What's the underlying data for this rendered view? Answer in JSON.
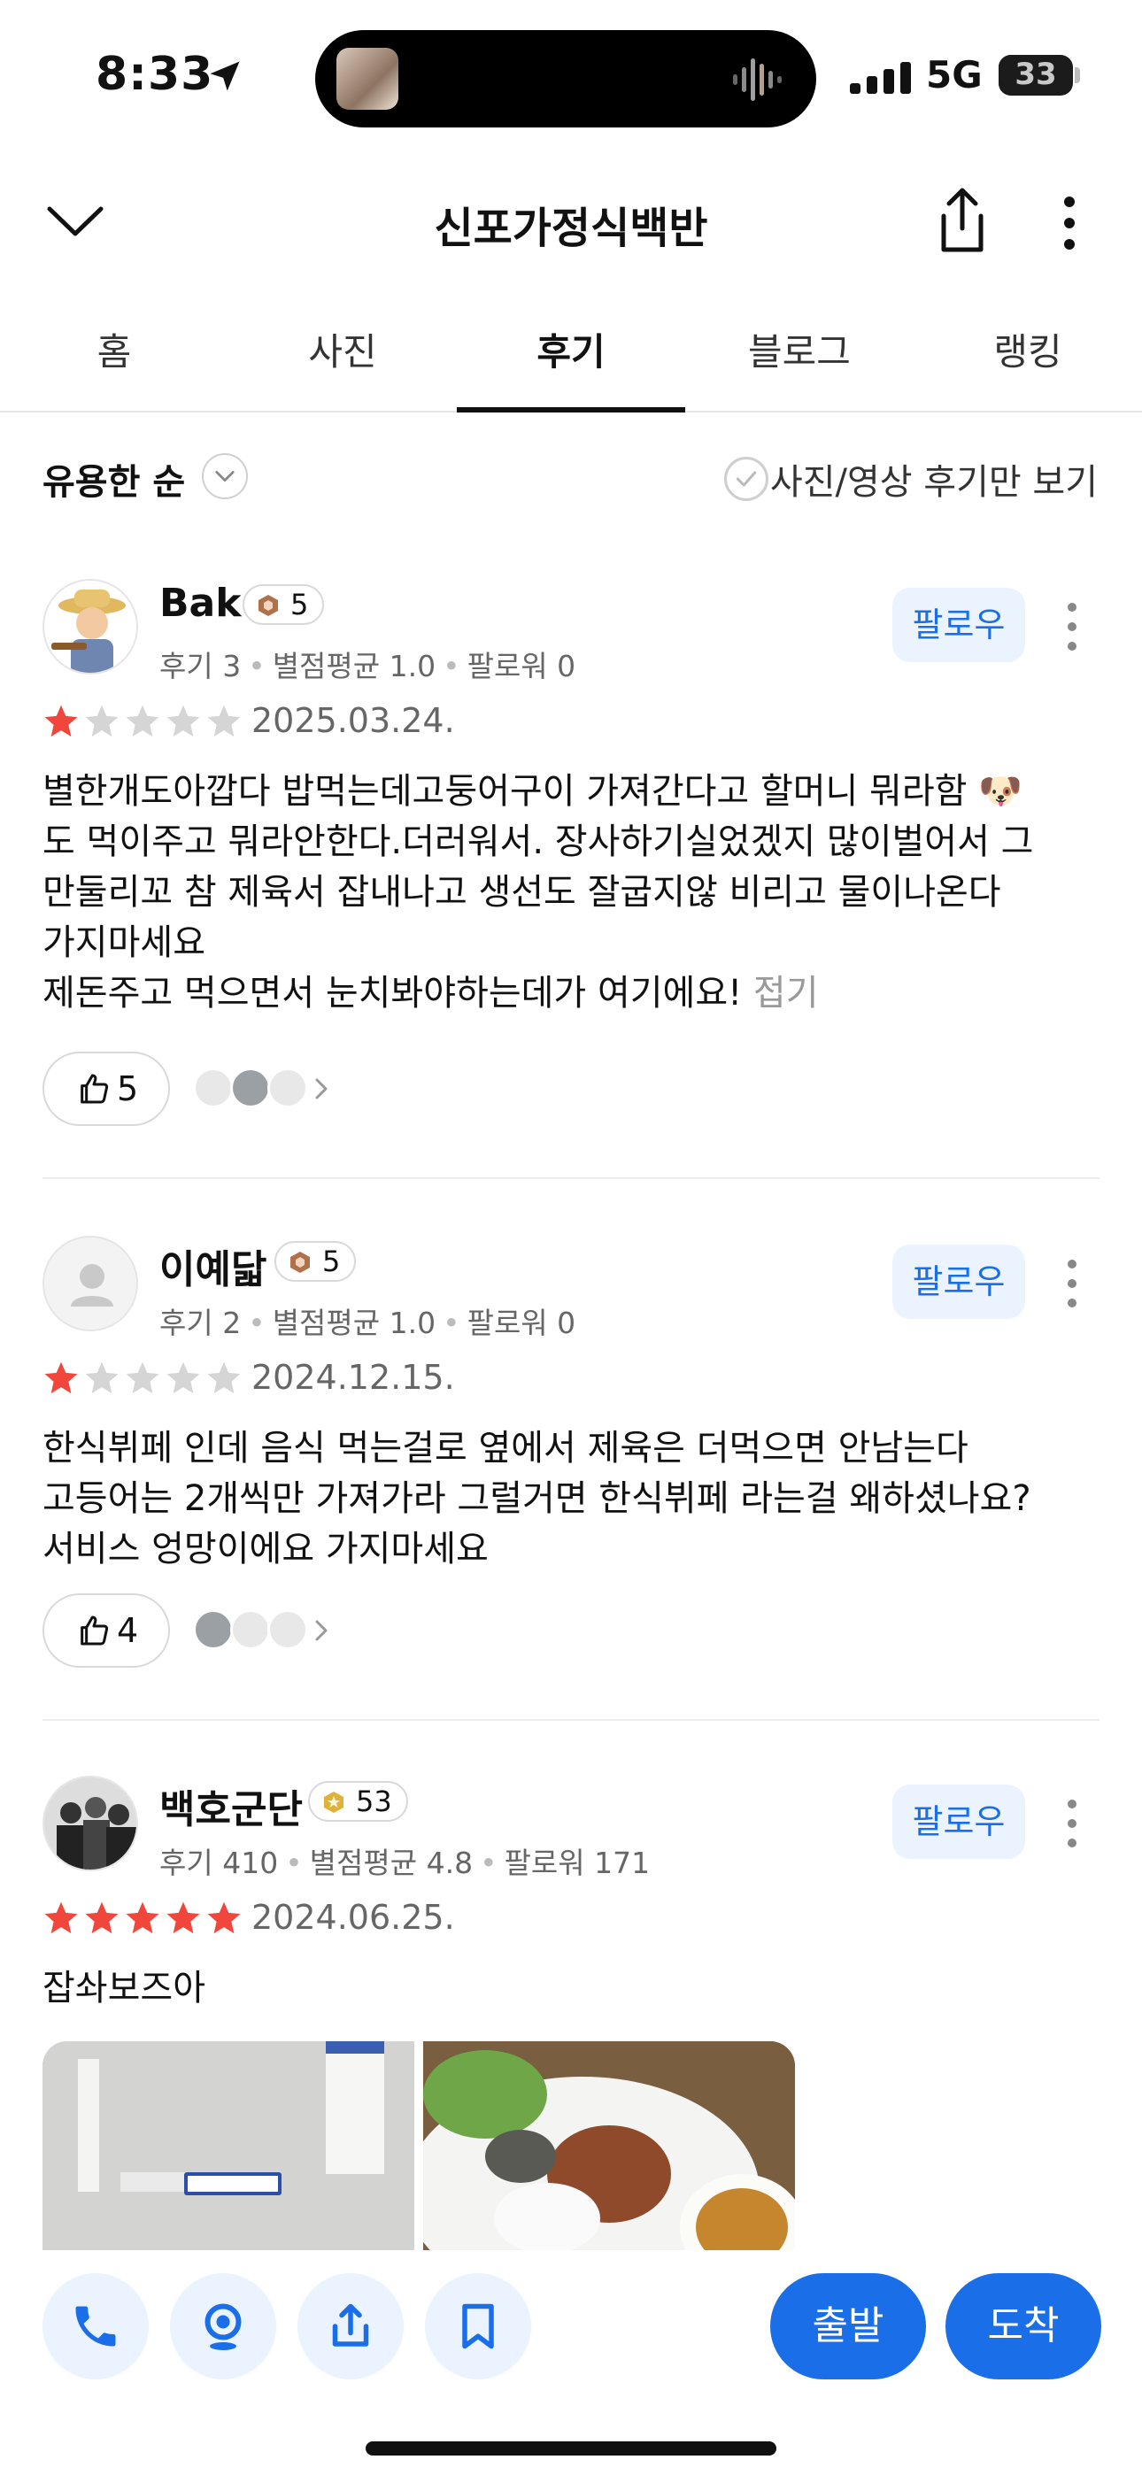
{
  "status": {
    "time": "8:33",
    "network": "5G",
    "battery": "33"
  },
  "header": {
    "title": "신포가정식백반"
  },
  "tabs": [
    {
      "label": "홈"
    },
    {
      "label": "사진"
    },
    {
      "label": "후기",
      "active": true
    },
    {
      "label": "블로그"
    },
    {
      "label": "랭킹"
    }
  ],
  "filter": {
    "sort": "유용한 순",
    "photo_only": "사진/영상 후기만 보기"
  },
  "reviews": [
    {
      "name": "Bak",
      "level": "5",
      "stats": {
        "reviews": "후기 3",
        "avg": "별점평균 1.0",
        "followers": "팔로워 0"
      },
      "follow": "팔로우",
      "rating": 1,
      "date": "2025.03.24.",
      "text": "별한개도아깝다 밥먹는데고둥어구이 가져간다고 할머니 뭐라함 🐶\n도 먹이주고 뭐라안한다.더러워서. 장사하기실었겠지 많이벌어서 그\n만둘리꼬 참 제육서 잡내나고 생선도 잘굽지않 비리고 물이나온다\n가지마세요\n제돈주고 먹으면서 눈치봐야하는데가 여기에요! ",
      "fold": "접기",
      "likes": "5"
    },
    {
      "name": "이예닯",
      "level": "5",
      "stats": {
        "reviews": "후기 2",
        "avg": "별점평균 1.0",
        "followers": "팔로워 0"
      },
      "follow": "팔로우",
      "rating": 1,
      "date": "2024.12.15.",
      "text": "한식뷔페 인데 음식 먹는걸로 옆에서 제육은 더먹으면 안남는다\n고등어는 2개씩만 가져가라 그럴거면 한식뷔페 라는걸 왜하셨나요?\n서비스 엉망이에요 가지마세요",
      "likes": "4"
    },
    {
      "name": "백호군단",
      "level": "53",
      "stats": {
        "reviews": "후기 410",
        "avg": "별점평균 4.8",
        "followers": "팔로워 171"
      },
      "follow": "팔로우",
      "rating": 5,
      "date": "2024.06.25.",
      "text": "잡솨보즈아"
    }
  ],
  "bottom": {
    "depart": "출발",
    "arrive": "도착"
  },
  "colors": {
    "accent": "#1a6fe8",
    "star_on": "#f0463c",
    "star_off": "#d5d5d5"
  }
}
